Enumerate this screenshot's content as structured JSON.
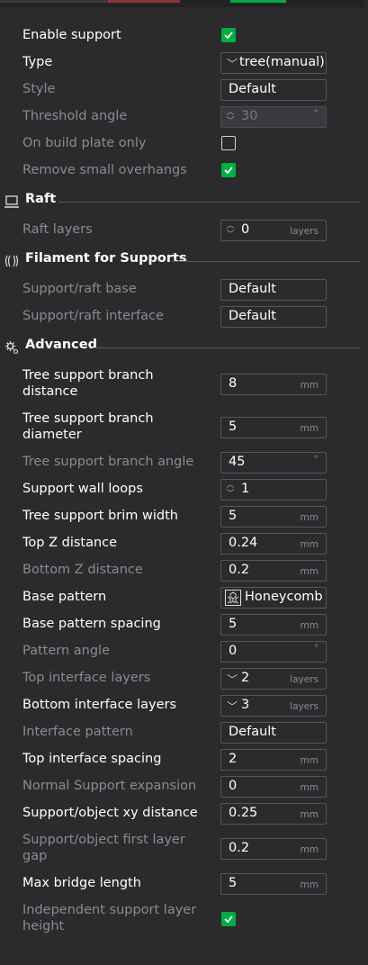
{
  "accent": "#00ae42",
  "general": {
    "enable_support": {
      "label": "Enable support",
      "checked": true
    },
    "type": {
      "label": "Type",
      "value": "tree(manual)"
    },
    "style": {
      "label": "Style",
      "value": "Default"
    },
    "threshold_angle": {
      "label": "Threshold angle",
      "value": "30",
      "unit": "°"
    },
    "on_build_plate_only": {
      "label": "On build plate only",
      "checked": false
    },
    "remove_small_overhangs": {
      "label": "Remove small overhangs",
      "checked": true
    }
  },
  "raft": {
    "title": "Raft",
    "raft_layers": {
      "label": "Raft layers",
      "value": "0",
      "unit": "layers"
    }
  },
  "filament": {
    "title": "Filament for Supports",
    "base": {
      "label": "Support/raft base",
      "value": "Default"
    },
    "interface": {
      "label": "Support/raft interface",
      "value": "Default"
    }
  },
  "advanced": {
    "title": "Advanced",
    "branch_distance": {
      "label_l1": "Tree support branch",
      "label_l2": "distance",
      "value": "8",
      "unit": "mm"
    },
    "branch_diameter": {
      "label_l1": "Tree support branch",
      "label_l2": "diameter",
      "value": "5",
      "unit": "mm"
    },
    "branch_angle": {
      "label": "Tree support branch angle",
      "value": "45",
      "unit": "°"
    },
    "wall_loops": {
      "label": "Support wall loops",
      "value": "1"
    },
    "brim_width": {
      "label": "Tree support brim width",
      "value": "5",
      "unit": "mm"
    },
    "top_z": {
      "label": "Top Z distance",
      "value": "0.24",
      "unit": "mm"
    },
    "bottom_z": {
      "label": "Bottom Z distance",
      "value": "0.2",
      "unit": "mm"
    },
    "base_pattern": {
      "label": "Base pattern",
      "value": "Honeycomb"
    },
    "base_pattern_spacing": {
      "label": "Base pattern spacing",
      "value": "5",
      "unit": "mm"
    },
    "pattern_angle": {
      "label": "Pattern angle",
      "value": "0",
      "unit": "°"
    },
    "top_interface_layers": {
      "label": "Top interface layers",
      "value": "2",
      "unit": "layers"
    },
    "bottom_interface_layers": {
      "label": "Bottom interface layers",
      "value": "3",
      "unit": "layers"
    },
    "interface_pattern": {
      "label": "Interface pattern",
      "value": "Default"
    },
    "top_interface_spacing": {
      "label": "Top interface spacing",
      "value": "2",
      "unit": "mm"
    },
    "normal_support_expansion": {
      "label": "Normal Support expansion",
      "value": "0",
      "unit": "mm"
    },
    "xy_distance": {
      "label": "Support/object xy distance",
      "value": "0.25",
      "unit": "mm"
    },
    "first_layer_gap": {
      "label_l1": "Support/object first layer",
      "label_l2": "gap",
      "value": "0.2",
      "unit": "mm"
    },
    "max_bridge_length": {
      "label": "Max bridge length",
      "value": "5",
      "unit": "mm"
    },
    "independent_layer_height": {
      "label_l1": "Independent support layer",
      "label_l2": "height",
      "checked": true
    }
  }
}
